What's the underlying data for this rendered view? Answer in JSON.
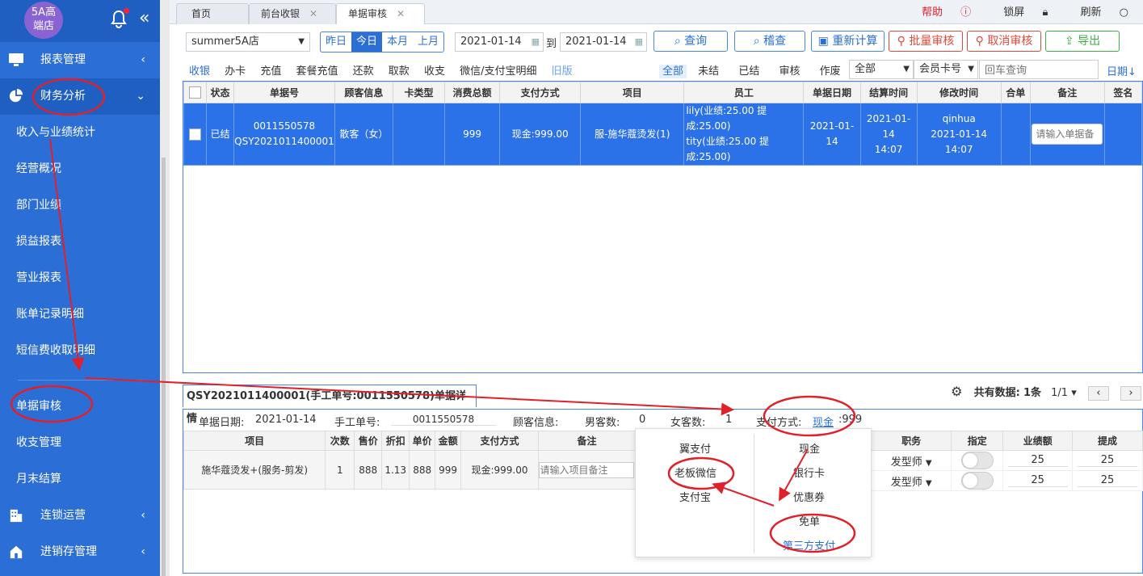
{
  "logo": "5A高端店",
  "logo_line1": "5A高",
  "logo_line2": "端店",
  "sidebar": {
    "groups": {
      "reports": "报表管理",
      "finance": "财务分析",
      "chain": "连锁运营",
      "inventory": "进销存管理"
    },
    "items": [
      "收入与业绩统计",
      "经营概况",
      "部门业绩",
      "损益报表",
      "营业报表",
      "账单记录明细",
      "短信费收取明细"
    ],
    "items2": [
      "单据审核",
      "收支管理",
      "月末结算"
    ]
  },
  "tabs": [
    "首页",
    "前台收银",
    "单据审核"
  ],
  "top_right": {
    "help": "帮助",
    "lock": "锁屏",
    "refresh": "刷新"
  },
  "toolbar": {
    "store": "summer5A店",
    "seg": [
      "昨日",
      "今日",
      "本月",
      "上月"
    ],
    "date_from": "2021-01-14",
    "to": "到",
    "date_to": "2021-01-14",
    "query": "查询",
    "audit": "稽查",
    "recalc": "重新计算",
    "batch_audit": "批量审核",
    "cancel_audit": "取消审核",
    "export": "导出"
  },
  "subnav": {
    "left": [
      "收银",
      "办卡",
      "充值",
      "套餐充值",
      "还款",
      "取款",
      "收支",
      "微信/支付宝明细"
    ],
    "old": "旧版",
    "status": [
      "全部",
      "未结",
      "已结",
      "审核",
      "作废"
    ],
    "filter1": "全部",
    "filter2": "会员卡号",
    "search_placeholder": "回车查询",
    "sort": "日期"
  },
  "grid": {
    "headers": [
      "状态",
      "单据号",
      "顾客信息",
      "卡类型",
      "消费总额",
      "支付方式",
      "项目",
      "员工",
      "单据日期",
      "结算时间",
      "修改时间",
      "合单",
      "备注",
      "签名"
    ],
    "row": {
      "status": "已结",
      "no1": "0011550578",
      "no2": "QSY2021011400001",
      "customer": "散客（女）",
      "card": "",
      "total": "999",
      "pay": "现金:999.00",
      "item": "服-施华蔻烫发(1)",
      "staff1": "lily(业绩:25.00 提成:25.00)",
      "staff2": "tity(业绩:25.00 提成:25.00)",
      "date": "2021-01-14",
      "settle1": "2021-01-14",
      "settle2": "14:07",
      "mod1": "qinhua",
      "mod2": "2021-01-14 14:07",
      "merge": "",
      "note_placeholder": "请输入单据备",
      "sign": ""
    }
  },
  "detail": {
    "title": "QSY2021011400001(手工单号:0011550578)单据详情",
    "pager_label": "共有数据:",
    "pager_count": "1条",
    "pager_page": "1/1",
    "date_label": "单据日期:",
    "date": "2021-01-14",
    "manual_label": "手工单号:",
    "manual": "0011550578",
    "customer_label": "顾客信息:",
    "male_label": "男客数:",
    "male": "0",
    "female_label": "女客数:",
    "female": "1",
    "pay_label": "支付方式:",
    "pay_link": "现金",
    "pay_amount": ":999",
    "headers": [
      "项目",
      "次数",
      "售价",
      "折扣",
      "单价",
      "金额",
      "支付方式",
      "备注"
    ],
    "row": {
      "item": "施华蔻烫发+(服务-剪发)",
      "count": "1",
      "price": "888",
      "discount": "1.13",
      "unit": "888",
      "amount": "999",
      "pay": "现金:999.00",
      "note_placeholder": "请输入项目备注"
    },
    "right_headers": [
      "职务",
      "指定",
      "业绩额",
      "提成"
    ],
    "staff_rows": [
      {
        "role": "发型师",
        "perf": "25",
        "comm": "25"
      },
      {
        "role": "发型师",
        "perf": "25",
        "comm": "25"
      }
    ]
  },
  "popup": {
    "left": [
      "翼支付",
      "老板微信",
      "支付宝"
    ],
    "right": [
      "现金",
      "银行卡",
      "优惠券",
      "免单",
      "第三方支付"
    ]
  },
  "colors": {
    "primary": "#2b6fd6",
    "danger": "#e0493a",
    "success": "#3fae49",
    "annotation": "#e0202a"
  }
}
